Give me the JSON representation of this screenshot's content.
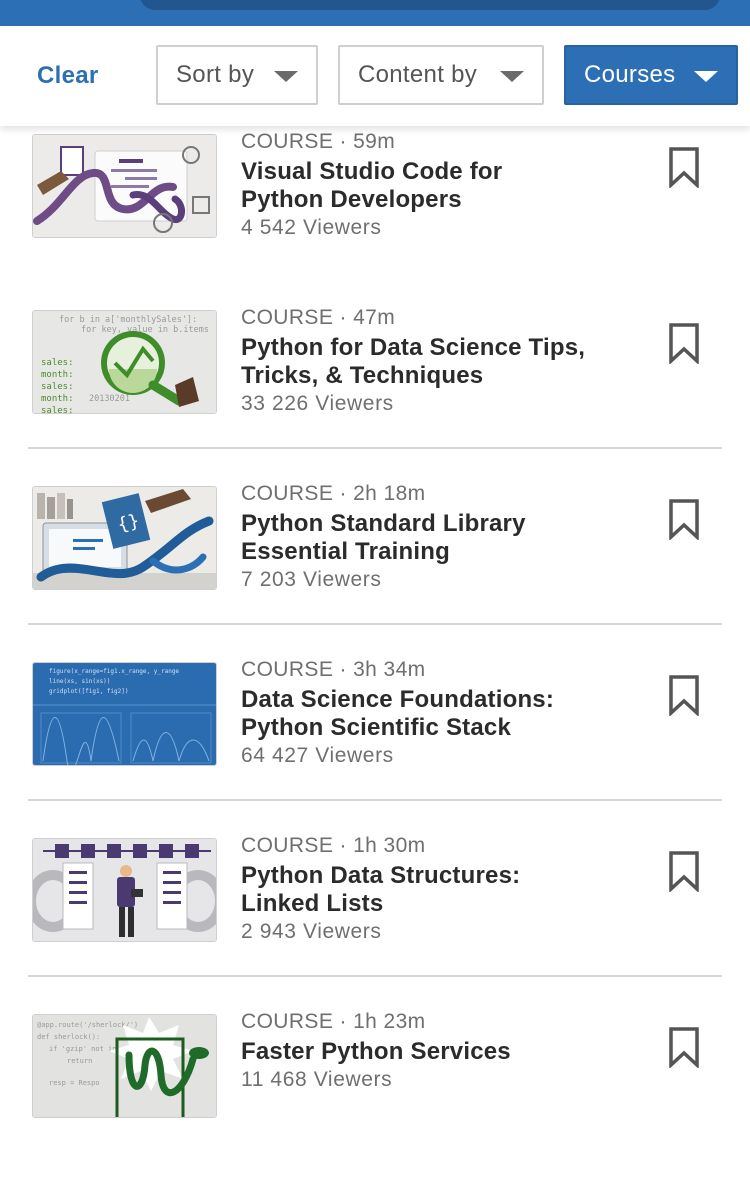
{
  "filters": {
    "clear_label": "Clear",
    "sort_label": "Sort by",
    "content_label": "Content by",
    "courses_label": "Courses"
  },
  "courses": [
    {
      "kind": "COURSE · 59m",
      "title_line1": "Visual Studio Code for",
      "title_line2": "Python Developers",
      "viewers": "4 542 Viewers",
      "thumb": "vscode-python-thumbnail"
    },
    {
      "kind": "COURSE · 47m",
      "title_line1": "Python for Data Science Tips,",
      "title_line2": "Tricks, & Techniques",
      "viewers": "33 226 Viewers",
      "thumb": "data-science-tips-thumbnail"
    },
    {
      "kind": "COURSE · 2h 18m",
      "title_line1": "Python Standard Library",
      "title_line2": "Essential Training",
      "viewers": "7 203 Viewers",
      "thumb": "standard-library-thumbnail"
    },
    {
      "kind": "COURSE · 3h 34m",
      "title_line1": "Data Science Foundations:",
      "title_line2": "Python Scientific Stack",
      "viewers": "64 427 Viewers",
      "thumb": "scientific-stack-thumbnail"
    },
    {
      "kind": "COURSE · 1h 30m",
      "title_line1": "Python Data Structures:",
      "title_line2": "Linked Lists",
      "viewers": "2 943 Viewers",
      "thumb": "linked-lists-thumbnail"
    },
    {
      "kind": "COURSE · 1h 23m",
      "title_line1": "Faster Python Services",
      "title_line2": "",
      "viewers": "11 468 Viewers",
      "thumb": "faster-services-thumbnail"
    }
  ],
  "thumb_code": {
    "t2": [
      "for b in a['monthlySales']:",
      "for key, value in b.items",
      "sales:",
      "month:",
      "sales:",
      "month:",
      "sales:",
      "20130201"
    ],
    "t4": [
      "figure(x_range=fig1.x_range, y_range",
      "line(xs, sin(xs))",
      "gridplot([fig1, fig2])"
    ],
    "t6": [
      "@app.route('/sherlock/')",
      "def sherlock():",
      "if 'gzip' not in",
      "return",
      "resp = Respo"
    ]
  },
  "colors": {
    "accent": "#2d6fb5",
    "topbar": "#2d6fb5",
    "separator": "#d6d6d6"
  }
}
